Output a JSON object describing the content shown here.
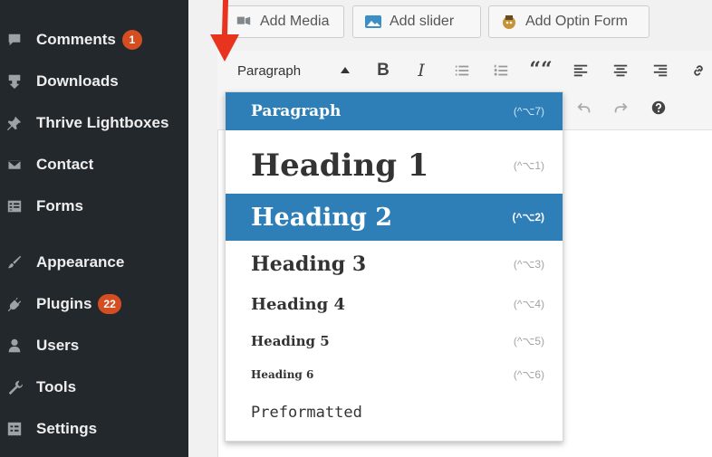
{
  "sidebar": {
    "items": [
      {
        "label": "Comments",
        "icon": "comment-icon",
        "badge": "1"
      },
      {
        "label": "Downloads",
        "icon": "download-icon",
        "badge": ""
      },
      {
        "label": "Thrive Lightboxes",
        "icon": "pin-icon",
        "badge": ""
      },
      {
        "label": "Contact",
        "icon": "mail-icon",
        "badge": ""
      },
      {
        "label": "Forms",
        "icon": "forms-icon",
        "badge": ""
      },
      {
        "label": "Appearance",
        "icon": "paintbrush-icon",
        "badge": ""
      },
      {
        "label": "Plugins",
        "icon": "plugin-icon",
        "badge": "22"
      },
      {
        "label": "Users",
        "icon": "users-icon",
        "badge": ""
      },
      {
        "label": "Tools",
        "icon": "wrench-icon",
        "badge": ""
      },
      {
        "label": "Settings",
        "icon": "settings-icon",
        "badge": ""
      }
    ]
  },
  "media_buttons": {
    "add_media": "Add Media",
    "add_slider": "Add slider",
    "add_optin": "Add Optin Form"
  },
  "toolbar": {
    "format_value": "Paragraph",
    "bold": "B",
    "italic": "I",
    "quote": "““"
  },
  "format_menu": {
    "items": [
      {
        "label": "Paragraph",
        "shortcut": "(^⌥7)"
      },
      {
        "label": "Heading 1",
        "shortcut": "(^⌥1)"
      },
      {
        "label": "Heading 2",
        "shortcut": "(^⌥2)"
      },
      {
        "label": "Heading 3",
        "shortcut": "(^⌥3)"
      },
      {
        "label": "Heading 4",
        "shortcut": "(^⌥4)"
      },
      {
        "label": "Heading 5",
        "shortcut": "(^⌥5)"
      },
      {
        "label": "Heading 6",
        "shortcut": "(^⌥6)"
      },
      {
        "label": "Preformatted",
        "shortcut": ""
      }
    ]
  },
  "colors": {
    "sidebar_bg": "#23282d",
    "badge": "#d54e21",
    "menu_highlight": "#2e7fb8",
    "arrow": "#e8331f"
  }
}
